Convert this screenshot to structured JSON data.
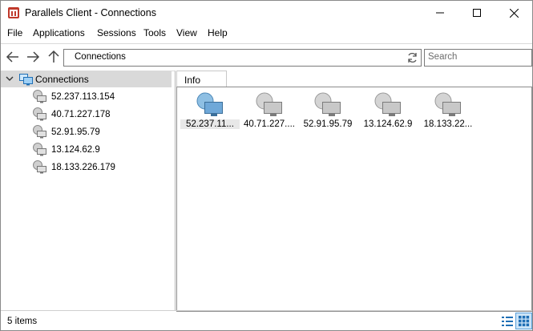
{
  "window": {
    "title": "Parallels Client - Connections"
  },
  "menu": [
    "File",
    "Applications",
    "Sessions",
    "Tools",
    "View",
    "Help"
  ],
  "toolbar": {
    "address": "Connections",
    "search_placeholder": "Search"
  },
  "tree": {
    "root_label": "Connections",
    "items": [
      "52.237.113.154",
      "40.71.227.178",
      "52.91.95.79",
      "13.124.62.9",
      "18.133.226.179"
    ]
  },
  "tabs": [
    "Info"
  ],
  "tiles": [
    "52.237.11...",
    "40.71.227....",
    "52.91.95.79",
    "13.124.62.9",
    "18.133.22..."
  ],
  "status": {
    "text": "5 items"
  }
}
